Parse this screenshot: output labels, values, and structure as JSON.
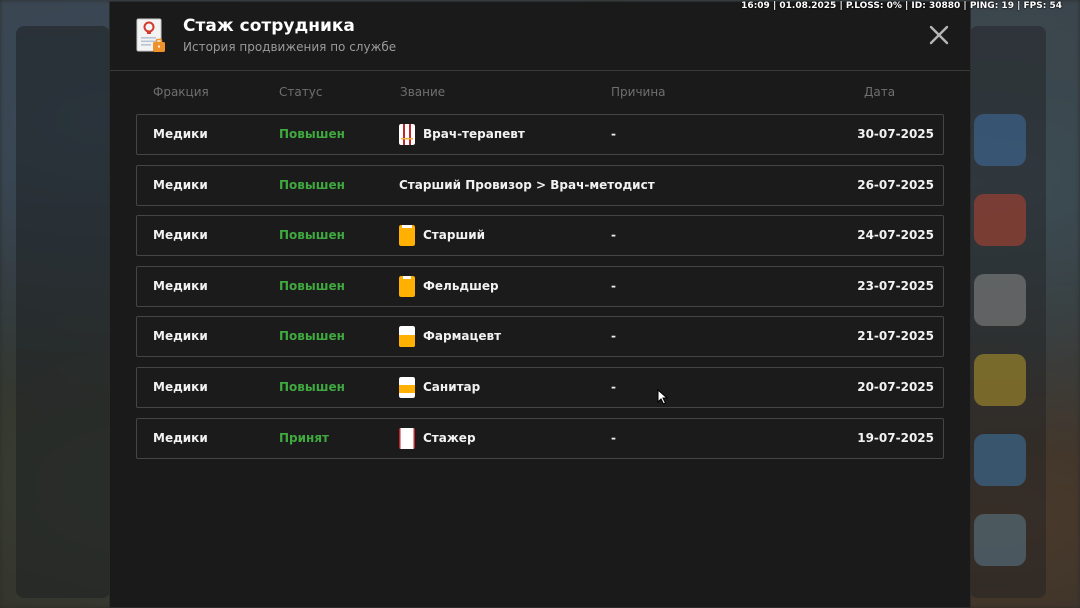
{
  "hud": {
    "text": "16:09 | 01.08.2025 | P.LOSS: 0% | ID: 30880 | PING: 19 | FPS: 54"
  },
  "modal": {
    "title": "Стаж сотрудника",
    "subtitle": "История продвижения по службе"
  },
  "columns": [
    "Фракция",
    "Статус",
    "Звание",
    "Причина",
    "Дата"
  ],
  "colors": {
    "status_green": "#3fa83f",
    "rank_orange": "#ffb000",
    "rank_red": "#c0262a"
  },
  "rows": [
    {
      "faction": "Медики",
      "status": "Повышен",
      "rank": "Врач-терапевт",
      "rank_icon": "coat-icon-red-stripes",
      "reason": "-",
      "date": "30-07-2025"
    },
    {
      "faction": "Медики",
      "status": "Повышен",
      "rank": "Старший Провизор > Врач-методист",
      "rank_icon": "",
      "reason": "",
      "date": "26-07-2025"
    },
    {
      "faction": "Медики",
      "status": "Повышен",
      "rank": "Старший",
      "rank_icon": "coat-icon-orange",
      "reason": "-",
      "date": "24-07-2025"
    },
    {
      "faction": "Медики",
      "status": "Повышен",
      "rank": "Фельдшер",
      "rank_icon": "coat-icon-orange",
      "reason": "-",
      "date": "23-07-2025"
    },
    {
      "faction": "Медики",
      "status": "Повышен",
      "rank": "Фармацевт",
      "rank_icon": "coat-icon-orange-bottom",
      "reason": "-",
      "date": "21-07-2025"
    },
    {
      "faction": "Медики",
      "status": "Повышен",
      "rank": "Санитар",
      "rank_icon": "coat-icon-orange-band",
      "reason": "-",
      "date": "20-07-2025"
    },
    {
      "faction": "Медики",
      "status": "Принят",
      "rank": "Стажер",
      "rank_icon": "coat-icon-white",
      "reason": "-",
      "date": "19-07-2025"
    }
  ]
}
